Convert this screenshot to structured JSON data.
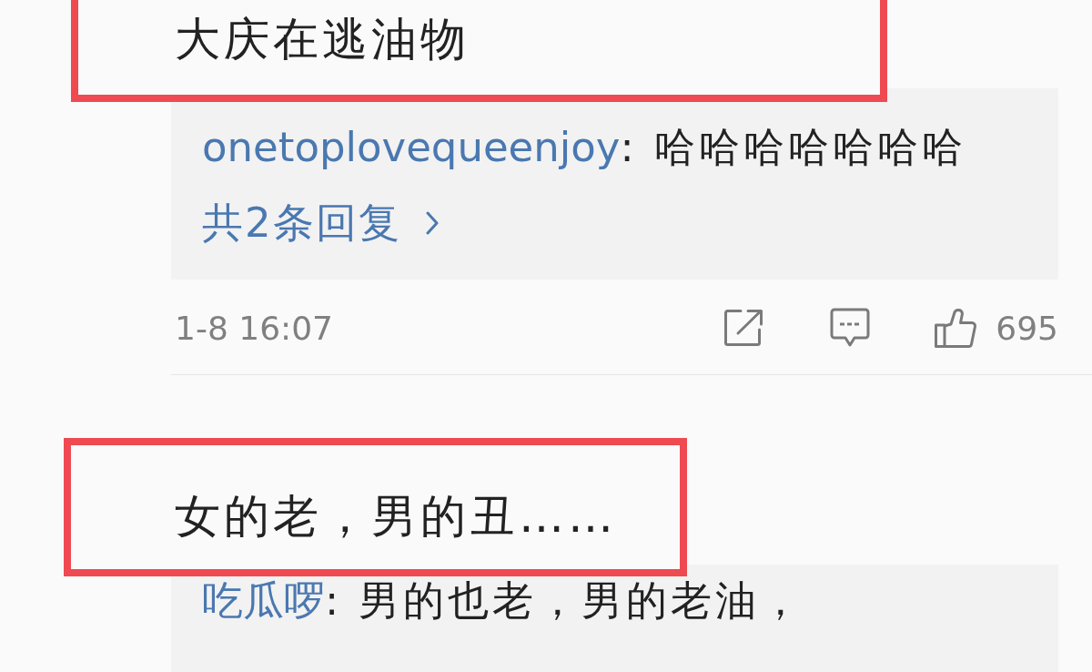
{
  "comments": [
    {
      "text": "大庆在逃油物",
      "highlighted": true,
      "replies": [
        {
          "user": "onetoplovequeenjoy",
          "text": ": 哈哈哈哈哈哈哈"
        }
      ],
      "more_replies": "共2条回复",
      "time": "1-8 16:07",
      "likes": "695"
    },
    {
      "text": "女的老，男的丑……",
      "highlighted": true,
      "replies": [
        {
          "user": "吃瓜啰",
          "text": ": 男的也老，男的老油，"
        }
      ]
    }
  ]
}
